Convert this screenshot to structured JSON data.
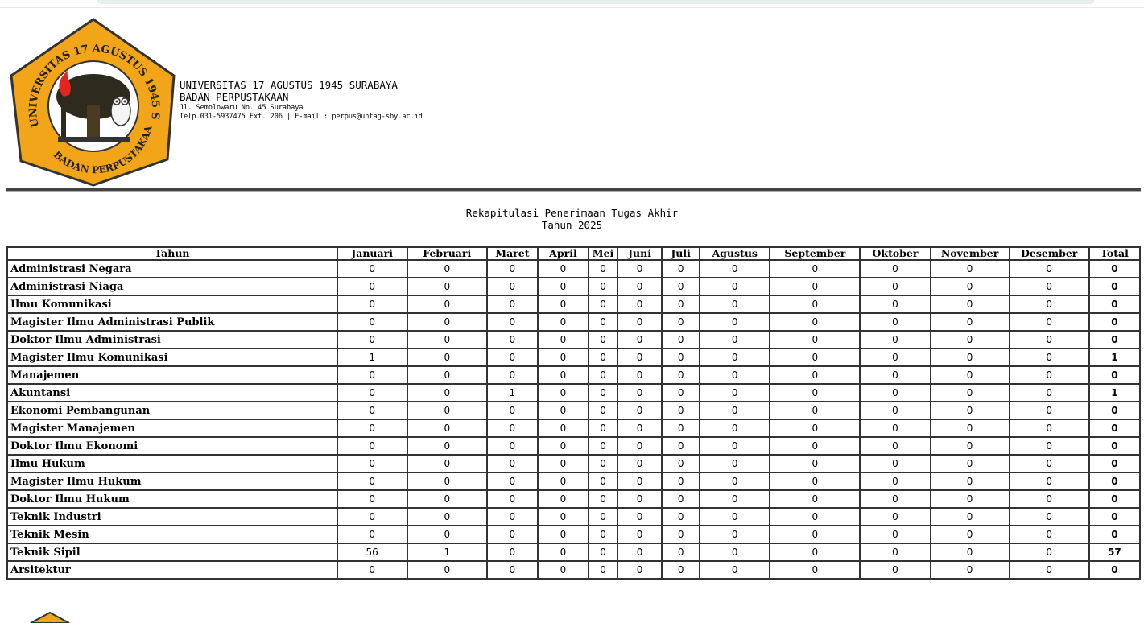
{
  "colors": {
    "logo_fill": "#f3a51a",
    "logo_outline": "#333333",
    "flame": "#e2261d",
    "tree": "#2f2a1e"
  },
  "header": {
    "logo_ring_top": "UNIVERSITAS 17 AGUSTUS 1945 SURABAYA",
    "logo_ring_bottom": "BADAN PERPUSTAKAAN",
    "university": "UNIVERSITAS 17 AGUSTUS 1945 SURABAYA",
    "department": "BADAN PERPUSTAKAAN",
    "address": "Jl. Semolowaru No. 45 Surabaya",
    "contact": "Telp.031-5937475 Ext. 206 | E-mail : perpus@untag-sby.ac.id"
  },
  "report": {
    "title": "Rekapitulasi Penerimaan Tugas Akhir",
    "subtitle": "Tahun 2025"
  },
  "table": {
    "columns": [
      "Tahun",
      "Januari",
      "Februari",
      "Maret",
      "April",
      "Mei",
      "Juni",
      "Juli",
      "Agustus",
      "September",
      "Oktober",
      "November",
      "Desember",
      "Total"
    ],
    "rows": [
      {
        "name": "Administrasi Negara",
        "values": [
          "0",
          "0",
          "0",
          "0",
          "0",
          "0",
          "0",
          "0",
          "0",
          "0",
          "0",
          "0"
        ],
        "total": "0"
      },
      {
        "name": "Administrasi Niaga",
        "values": [
          "0",
          "0",
          "0",
          "0",
          "0",
          "0",
          "0",
          "0",
          "0",
          "0",
          "0",
          "0"
        ],
        "total": "0"
      },
      {
        "name": "Ilmu Komunikasi",
        "values": [
          "0",
          "0",
          "0",
          "0",
          "0",
          "0",
          "0",
          "0",
          "0",
          "0",
          "0",
          "0"
        ],
        "total": "0"
      },
      {
        "name": "Magister Ilmu Administrasi Publik",
        "values": [
          "0",
          "0",
          "0",
          "0",
          "0",
          "0",
          "0",
          "0",
          "0",
          "0",
          "0",
          "0"
        ],
        "total": "0"
      },
      {
        "name": "Doktor Ilmu Administrasi",
        "values": [
          "0",
          "0",
          "0",
          "0",
          "0",
          "0",
          "0",
          "0",
          "0",
          "0",
          "0",
          "0"
        ],
        "total": "0"
      },
      {
        "name": "Magister Ilmu Komunikasi",
        "values": [
          "1",
          "0",
          "0",
          "0",
          "0",
          "0",
          "0",
          "0",
          "0",
          "0",
          "0",
          "0"
        ],
        "total": "1"
      },
      {
        "name": "Manajemen",
        "values": [
          "0",
          "0",
          "0",
          "0",
          "0",
          "0",
          "0",
          "0",
          "0",
          "0",
          "0",
          "0"
        ],
        "total": "0"
      },
      {
        "name": "Akuntansi",
        "values": [
          "0",
          "0",
          "1",
          "0",
          "0",
          "0",
          "0",
          "0",
          "0",
          "0",
          "0",
          "0"
        ],
        "total": "1"
      },
      {
        "name": "Ekonomi Pembangunan",
        "values": [
          "0",
          "0",
          "0",
          "0",
          "0",
          "0",
          "0",
          "0",
          "0",
          "0",
          "0",
          "0"
        ],
        "total": "0"
      },
      {
        "name": "Magister Manajemen",
        "values": [
          "0",
          "0",
          "0",
          "0",
          "0",
          "0",
          "0",
          "0",
          "0",
          "0",
          "0",
          "0"
        ],
        "total": "0"
      },
      {
        "name": "Doktor Ilmu Ekonomi",
        "values": [
          "0",
          "0",
          "0",
          "0",
          "0",
          "0",
          "0",
          "0",
          "0",
          "0",
          "0",
          "0"
        ],
        "total": "0"
      },
      {
        "name": "Ilmu Hukum",
        "values": [
          "0",
          "0",
          "0",
          "0",
          "0",
          "0",
          "0",
          "0",
          "0",
          "0",
          "0",
          "0"
        ],
        "total": "0"
      },
      {
        "name": "Magister Ilmu Hukum",
        "values": [
          "0",
          "0",
          "0",
          "0",
          "0",
          "0",
          "0",
          "0",
          "0",
          "0",
          "0",
          "0"
        ],
        "total": "0"
      },
      {
        "name": "Doktor Ilmu Hukum",
        "values": [
          "0",
          "0",
          "0",
          "0",
          "0",
          "0",
          "0",
          "0",
          "0",
          "0",
          "0",
          "0"
        ],
        "total": "0"
      },
      {
        "name": "Teknik Industri",
        "values": [
          "0",
          "0",
          "0",
          "0",
          "0",
          "0",
          "0",
          "0",
          "0",
          "0",
          "0",
          "0"
        ],
        "total": "0"
      },
      {
        "name": "Teknik Mesin",
        "values": [
          "0",
          "0",
          "0",
          "0",
          "0",
          "0",
          "0",
          "0",
          "0",
          "0",
          "0",
          "0"
        ],
        "total": "0"
      },
      {
        "name": "Teknik Sipil",
        "values": [
          "56",
          "1",
          "0",
          "0",
          "0",
          "0",
          "0",
          "0",
          "0",
          "0",
          "0",
          "0"
        ],
        "total": "57"
      },
      {
        "name": "Arsitektur",
        "values": [
          "0",
          "0",
          "0",
          "0",
          "0",
          "0",
          "0",
          "0",
          "0",
          "0",
          "0",
          "0"
        ],
        "total": "0"
      }
    ]
  }
}
